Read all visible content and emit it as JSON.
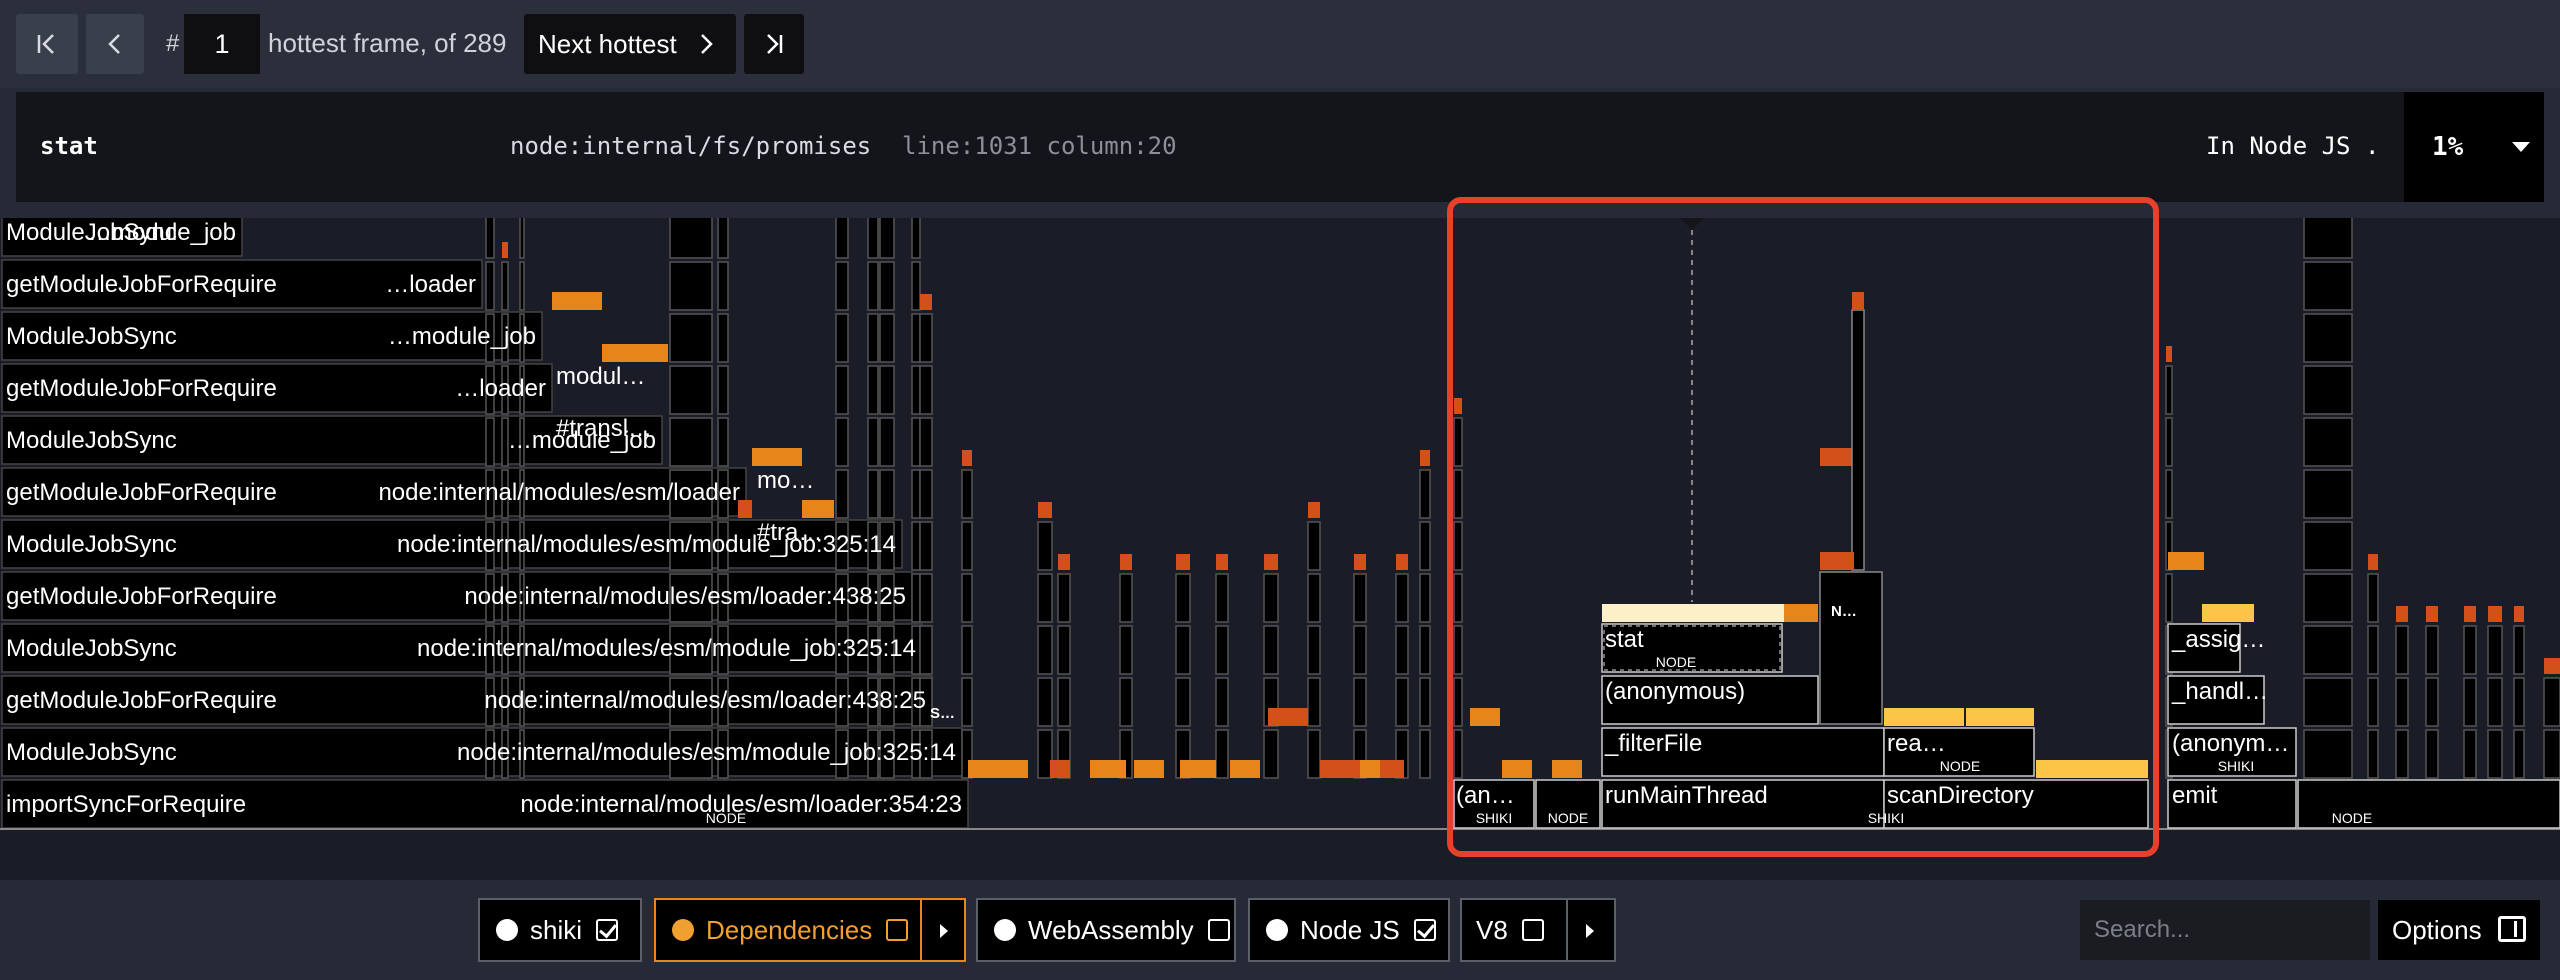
{
  "nav": {
    "first_label": "",
    "prev_label": "",
    "hash": "#",
    "frame_index": "1",
    "hottest_text": "hottest frame, of 289",
    "next_label": "Next hottest",
    "last_label": ""
  },
  "info": {
    "function": "stat",
    "file": "node:internal/fs/promises",
    "line_col": "line:1031 column:20",
    "category": "In Node JS .",
    "percent": "1%"
  },
  "flame": {
    "rows": [
      {
        "name": "ModuleJobSync",
        "loc": "…module_job"
      },
      {
        "name": "getModuleJobForRequire",
        "loc": "…loader"
      },
      {
        "name": "ModuleJobSync",
        "loc": "…module_job"
      },
      {
        "name": "getModuleJobForRequire",
        "loc": "…loader"
      },
      {
        "name": "ModuleJobSync",
        "loc": "…module_job"
      },
      {
        "name": "getModuleJobForRequire",
        "loc": "node:internal/modules/esm/loader"
      },
      {
        "name": "ModuleJobSync",
        "loc": "node:internal/modules/esm/module_job:325:14"
      },
      {
        "name": "getModuleJobForRequire",
        "loc": "node:internal/modules/esm/loader:438:25"
      },
      {
        "name": "ModuleJobSync",
        "loc": "node:internal/modules/esm/module_job:325:14"
      },
      {
        "name": "getModuleJobForRequire",
        "loc": "node:internal/modules/esm/loader:438:25"
      },
      {
        "name": "ModuleJobSync",
        "loc": "node:internal/modules/esm/module_job:325:14"
      },
      {
        "name": "importSyncForRequire",
        "loc": "node:internal/modules/esm/loader:354:23"
      }
    ],
    "tags": {
      "node": "NODE",
      "shiki": "SHIKI"
    },
    "mid_labels": [
      "modul…",
      "#transl…",
      "mo…",
      "#tra…",
      "S…",
      "N…"
    ],
    "selected": {
      "stat": "stat",
      "anonymous": "(anonymous)",
      "filterFile": "_filterFile",
      "runMainThread": "runMainThread",
      "rea": "rea…",
      "scanDirectory": "scanDirectory",
      "an": "(an…"
    },
    "right": {
      "assig": "_assig…",
      "handl": "_handl…",
      "anonym": "(anonym…",
      "emit": "emit"
    }
  },
  "filters": [
    {
      "label": "shiki",
      "checked": true
    },
    {
      "label": "Dependencies",
      "checked": false
    },
    {
      "label": "WebAssembly",
      "checked": false
    },
    {
      "label": "Node JS",
      "checked": true
    },
    {
      "label": "V8",
      "checked": false
    }
  ],
  "search": {
    "placeholder": "Search..."
  },
  "options_label": "Options",
  "colors": {
    "orange": "#e8851a",
    "dark_orange": "#d4501a",
    "yellow": "#fbc547",
    "highlight": "#e8402a"
  }
}
